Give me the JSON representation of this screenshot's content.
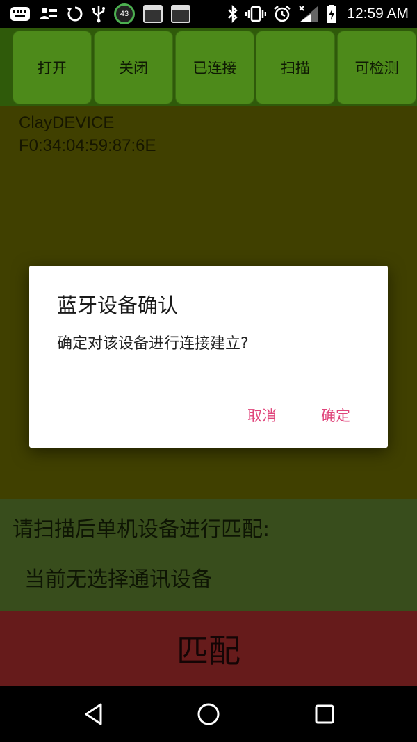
{
  "status_bar": {
    "time": "12:59 AM",
    "badge_number": "43",
    "icons": [
      "keyboard-icon",
      "account-switch-icon",
      "sync-icon",
      "usb-icon",
      "counter-badge-icon",
      "calendar-icon",
      "calendar-icon",
      "bluetooth-icon",
      "vibrate-icon",
      "alarm-icon",
      "signal-icon",
      "battery-charging-icon"
    ]
  },
  "toolbar": {
    "buttons": [
      {
        "label": "打开"
      },
      {
        "label": "关闭"
      },
      {
        "label": "已连接"
      },
      {
        "label": "扫描"
      },
      {
        "label": "可检测"
      }
    ]
  },
  "device": {
    "name": "ClayDEVICE",
    "mac": "F0:34:04:59:87:6E"
  },
  "dialog": {
    "title": "蓝牙设备确认",
    "message": "确定对该设备进行连接建立?",
    "cancel_label": "取消",
    "ok_label": "确定",
    "accent_color": "#e0457b"
  },
  "pair_panel": {
    "hint": "请扫描后单机设备进行匹配:",
    "status": "当前无选择通讯设备"
  },
  "pair_button": {
    "label": "匹配"
  },
  "nav_bar": {
    "icons": [
      "back-icon",
      "home-icon",
      "recents-icon"
    ]
  }
}
